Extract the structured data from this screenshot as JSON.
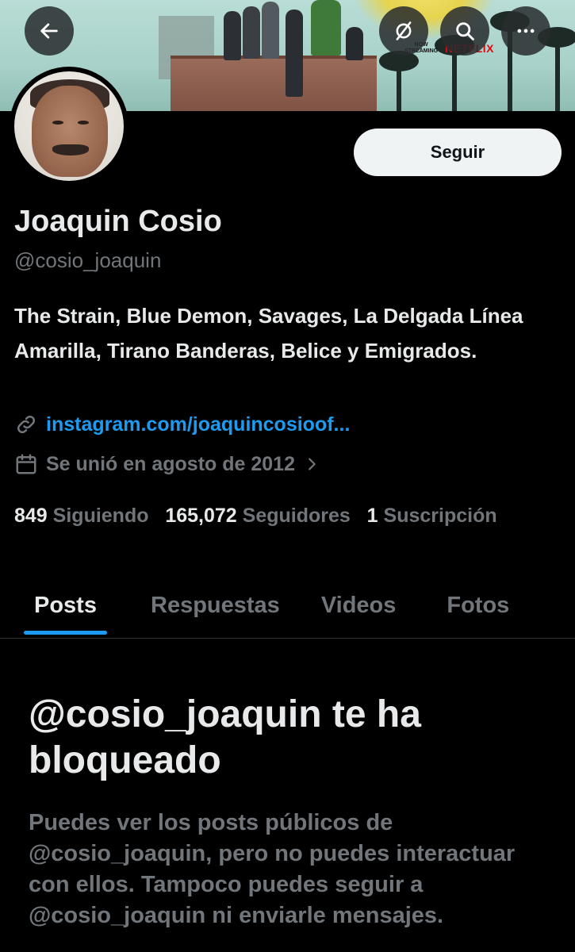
{
  "header": {
    "back_icon": "arrow-left-icon",
    "grok_icon": "slash-circle-icon",
    "search_icon": "search-icon",
    "more_icon": "more-horizontal-icon",
    "banner": {
      "now_streaming": "NOW STREAMING",
      "brand": "NETFLIX"
    }
  },
  "profile": {
    "follow_label": "Seguir",
    "name": "Joaquin Cosio",
    "handle": "@cosio_joaquin",
    "bio": "The Strain, Blue Demon, Savages, La Delgada Línea Amarilla, Tirano Banderas, Belice y Emigrados.",
    "link": "instagram.com/joaquincosioof...",
    "joined": "Se unió en agosto de 2012",
    "following_count": "849",
    "following_label": "Siguiendo",
    "followers_count": "165,072",
    "followers_label": "Seguidores",
    "subscriptions_count": "1",
    "subscriptions_label": "Suscripción"
  },
  "tabs": [
    {
      "label": "Posts",
      "active": true
    },
    {
      "label": "Respuestas",
      "active": false
    },
    {
      "label": "Videos",
      "active": false
    },
    {
      "label": "Fotos",
      "active": false
    }
  ],
  "blocked": {
    "title": "@cosio_joaquin te ha bloqueado",
    "description": "Puedes ver los posts públicos de @cosio_joaquin, pero no puedes interactuar con ellos. Tampoco puedes seguir a @cosio_joaquin ni enviarle mensajes."
  },
  "colors": {
    "background": "#000000",
    "accent": "#1d9bf0",
    "muted": "#71767b",
    "text": "#e7e9ea"
  }
}
